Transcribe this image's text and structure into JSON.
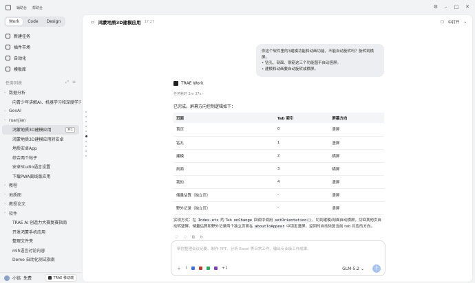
{
  "sidebar": {
    "top_labels": [
      "辅助台",
      "帮助台"
    ],
    "tabs": [
      "Work",
      "Code",
      "Design"
    ],
    "nav": [
      {
        "label": "新建任务",
        "icon": "new-task-icon"
      },
      {
        "label": "插件市场",
        "icon": "plugin-icon"
      },
      {
        "label": "自动化",
        "icon": "automation-icon"
      },
      {
        "label": "模板库",
        "icon": "template-icon"
      }
    ],
    "section_title": "任务列表",
    "tree": [
      {
        "type": "group",
        "label": "数据分析"
      },
      {
        "type": "child",
        "label": "向青少年讲解AI、机器学习和深度学习"
      },
      {
        "type": "group",
        "label": "GeoAI"
      },
      {
        "type": "group",
        "label": "ruanjian"
      },
      {
        "type": "child",
        "label": "鸿蒙地质3D建模应用",
        "selected": true,
        "shortcut": "⌘1"
      },
      {
        "type": "child",
        "label": "鸿蒙地质3D建模应用转安卓"
      },
      {
        "type": "child",
        "label": "地质安卓App"
      },
      {
        "type": "child",
        "label": "综合两个帖子"
      },
      {
        "type": "child",
        "label": "安卓Studio语言设置"
      },
      {
        "type": "child",
        "label": "下载PWA离线版应用"
      },
      {
        "type": "group",
        "label": "教程"
      },
      {
        "type": "group",
        "label": "地质图"
      },
      {
        "type": "group",
        "label": "教授论文"
      },
      {
        "type": "group",
        "label": "软件"
      },
      {
        "type": "child",
        "label": "TRAE AI 创造力大赛复赛指南"
      },
      {
        "type": "child",
        "label": "开发鸿蒙手机应用"
      },
      {
        "type": "child",
        "label": "整理文件夹"
      },
      {
        "type": "child",
        "label": "mlh语言讨论内容"
      },
      {
        "type": "child",
        "label": "Demo 自动化测试指南"
      }
    ],
    "footer": {
      "user": "小铭",
      "plan": "免费",
      "button": "TRAE 移动端"
    }
  },
  "header": {
    "title": "鸿蒙地质3D建模应用",
    "time": "17:27",
    "right_label": "中打开"
  },
  "conversation": {
    "user_message": [
      "你这个软件里的3建模功能和动画功能，不能自动旋转吗？旋转到横屏。",
      "• 钻孔、剖面、钢筋这三个功能图不自动竖屏。",
      "• 建模和动画要自动旋转成横屏。"
    ],
    "agent_name": "TRAE Work",
    "task_time": "任务耗时 2m 37s",
    "intro": "已完成。屏幕方向控制逻辑如下：",
    "table": {
      "headers": [
        "页面",
        "Tab 索引",
        "屏幕方向"
      ],
      "rows": [
        [
          "首页",
          "0",
          "竖屏"
        ],
        [
          "钻孔",
          "1",
          "竖屏"
        ],
        [
          "建模",
          "2",
          "横屏"
        ],
        [
          "剖面",
          "3",
          "横屏"
        ],
        [
          "我的",
          "4",
          "竖屏"
        ],
        [
          "储量估算（独立页）",
          "-",
          "竖屏"
        ],
        [
          "野外记录（独立页）",
          "-",
          "竖屏"
        ]
      ]
    },
    "implementation": {
      "p1": "实现方式：在 ",
      "c1": "Index.ets",
      "p2": " 的 Tab ",
      "c2": "onChange",
      "p3": " 回调中调用 ",
      "c3": "setOrientation()",
      "p4": "，切到建模/剖面自动横屏，切回其他页自动转竖屏。储量估算和野外记录两个独立页面在 ",
      "c4": "aboutToAppear",
      "p5": " 中锁定竖屏，返回时自动恢复当前 tab 对应的方向。"
    }
  },
  "composer": {
    "placeholder": "帮你整理会议纪要、制作 PPT、分析 Excel 等日常工作、输出专业级工作成果。",
    "extra_count": "+1",
    "model": "GLM-5.2"
  }
}
